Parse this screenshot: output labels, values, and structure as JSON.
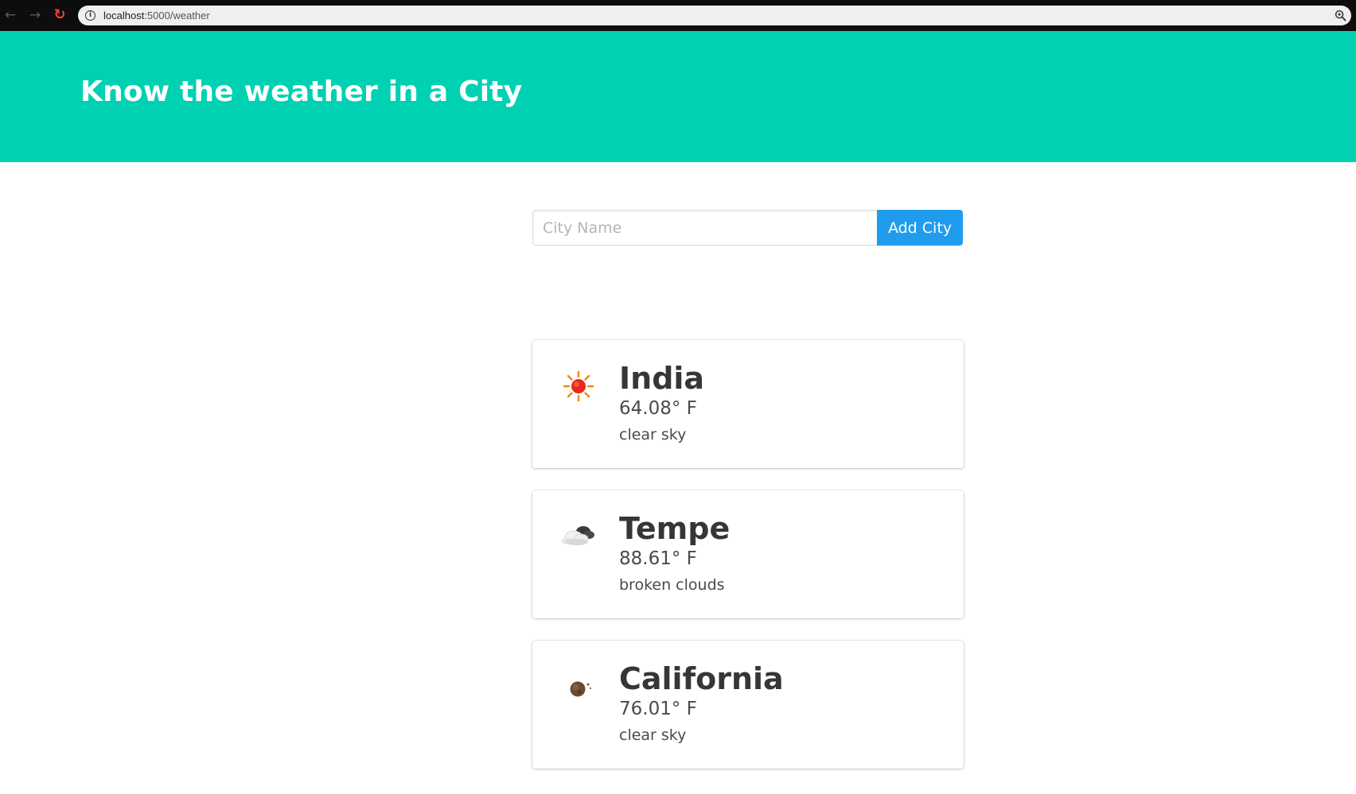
{
  "browser": {
    "back_icon": "←",
    "forward_icon": "→",
    "reload_icon": "↻",
    "url_host": "localhost",
    "url_path": ":5000/weather",
    "info_icon": "i"
  },
  "hero": {
    "title": "Know the weather in a City",
    "background_color": "#00d1b2"
  },
  "form": {
    "input_placeholder": "City Name",
    "input_value": "",
    "button_label": "Add City",
    "button_color": "#209cee"
  },
  "cities": [
    {
      "name": "India",
      "temperature": "64.08° F",
      "description": "clear sky",
      "icon": "sun-icon"
    },
    {
      "name": "Tempe",
      "temperature": "88.61° F",
      "description": "broken clouds",
      "icon": "broken-clouds-icon"
    },
    {
      "name": "California",
      "temperature": "76.01° F",
      "description": "clear sky",
      "icon": "clear-sky-night-icon"
    }
  ]
}
